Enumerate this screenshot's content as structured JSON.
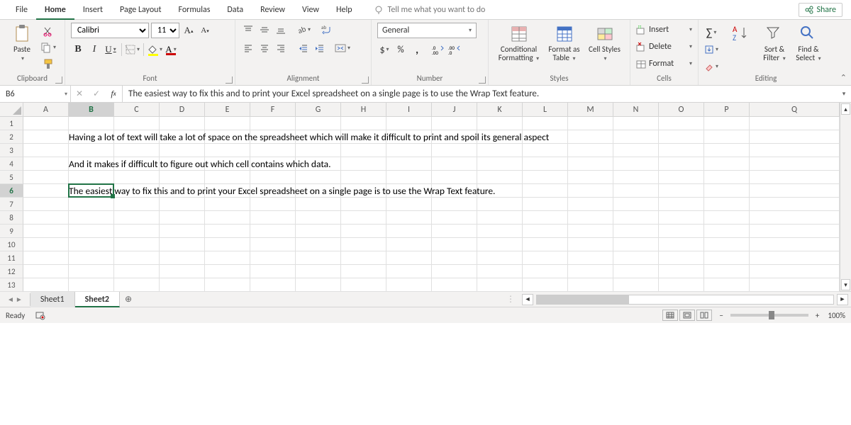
{
  "menu": {
    "file": "File",
    "home": "Home",
    "insert": "Insert",
    "pagelayout": "Page Layout",
    "formulas": "Formulas",
    "data": "Data",
    "review": "Review",
    "view": "View",
    "help": "Help",
    "tellme": "Tell me what you want to do",
    "share": "Share"
  },
  "ribbon": {
    "clipboard": {
      "label": "Clipboard",
      "paste": "Paste"
    },
    "font": {
      "label": "Font",
      "name": "Calibri",
      "size": "11"
    },
    "alignment": {
      "label": "Alignment"
    },
    "number": {
      "label": "Number",
      "format": "General"
    },
    "styles": {
      "label": "Styles",
      "cond": "Conditional Formatting",
      "fmt": "Format as Table",
      "cell": "Cell Styles"
    },
    "cells": {
      "label": "Cells",
      "insert": "Insert",
      "delete": "Delete",
      "format": "Format"
    },
    "editing": {
      "label": "Editing",
      "sort": "Sort & Filter",
      "find": "Find & Select"
    }
  },
  "namebox": "B6",
  "formula": "The easiest way to fix this and to print your Excel spreadsheet on a single page is to use the Wrap Text feature.",
  "columns": [
    "A",
    "B",
    "C",
    "D",
    "E",
    "F",
    "G",
    "H",
    "I",
    "J",
    "K",
    "L",
    "M",
    "N",
    "O",
    "P",
    "Q"
  ],
  "rows": [
    "1",
    "2",
    "3",
    "4",
    "5",
    "6",
    "7",
    "8",
    "9",
    "10",
    "11",
    "12",
    "13"
  ],
  "cellB2": "Having a lot of text will take a lot of space on the spreadsheet which will make it difficult to print and spoil its general aspect",
  "cellB4": "And it makes if difficult to figure out which cell contains which data.",
  "cellB6": "The easiest way to fix this and to print your Excel spreadsheet on a single page is to use the Wrap Text feature.",
  "sheets": {
    "s1": "Sheet1",
    "s2": "Sheet2"
  },
  "status": {
    "ready": "Ready",
    "zoom": "100%"
  }
}
